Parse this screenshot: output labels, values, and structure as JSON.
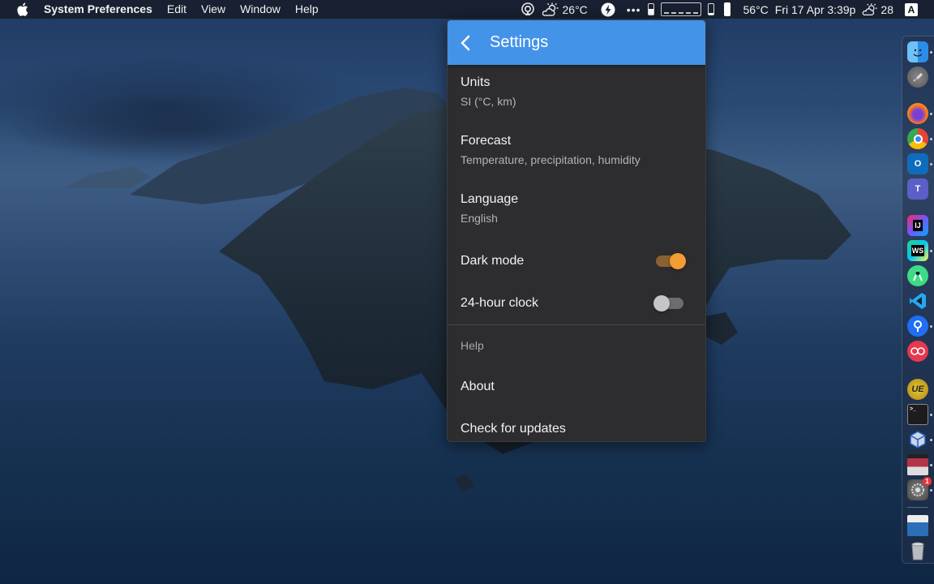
{
  "menubar": {
    "app_name": "System Preferences",
    "menus": [
      "Edit",
      "View",
      "Window",
      "Help"
    ],
    "status": {
      "weather_temp": "26°C",
      "cpu_temp": "56°C",
      "datetime": "Fri 17 Apr 3:39p",
      "weather_temp2": "28",
      "input_source": "A"
    }
  },
  "settings": {
    "title": "Settings",
    "rows": [
      {
        "primary": "Units",
        "secondary": "SI (°C, km)"
      },
      {
        "primary": "Forecast",
        "secondary": "Temperature, precipitation, humidity"
      },
      {
        "primary": "Language",
        "secondary": "English"
      }
    ],
    "toggles": [
      {
        "label": "Dark mode",
        "on": true
      },
      {
        "label": "24-hour clock",
        "on": false
      }
    ],
    "help_header": "Help",
    "help_items": [
      "About",
      "Check for updates"
    ],
    "colors": {
      "header": "#4393e8",
      "toggle_on": "#f39c33",
      "panel": "#2d2d2f"
    }
  },
  "dock": {
    "items": [
      {
        "name": "Finder",
        "icon": "finder-icon",
        "running": true
      },
      {
        "name": "Launchpad",
        "icon": "launchpad-icon",
        "running": false
      },
      {
        "name": "Firefox",
        "icon": "firefox-icon",
        "running": true
      },
      {
        "name": "Chrome",
        "icon": "chrome-icon",
        "running": true
      },
      {
        "name": "Outlook",
        "icon": "outlook-icon",
        "running": true
      },
      {
        "name": "Teams",
        "icon": "teams-icon",
        "running": false
      },
      {
        "name": "IntelliJ IDEA",
        "icon": "intellij-icon",
        "running": false
      },
      {
        "name": "WebStorm",
        "icon": "webstorm-icon",
        "running": true
      },
      {
        "name": "Android Studio",
        "icon": "android-studio-icon",
        "running": false
      },
      {
        "name": "VS Code",
        "icon": "vscode-icon",
        "running": false
      },
      {
        "name": "Sourcetree",
        "icon": "sourcetree-icon",
        "running": true
      },
      {
        "name": "Flickr",
        "icon": "flickr-icon",
        "running": false
      },
      {
        "name": "UltraEdit",
        "icon": "ultraedit-icon",
        "running": false
      },
      {
        "name": "Terminal",
        "icon": "terminal-icon",
        "running": true
      },
      {
        "name": "VirtualBox",
        "icon": "virtualbox-icon",
        "running": true
      },
      {
        "name": "Screenshot Editor",
        "icon": "screenshot-editor-icon",
        "running": true
      },
      {
        "name": "System Preferences",
        "icon": "system-preferences-icon",
        "running": true,
        "badge": "1"
      },
      {
        "name": "Downloads",
        "icon": "downloads-folder-icon",
        "running": false
      },
      {
        "name": "Trash",
        "icon": "trash-icon",
        "running": false
      }
    ]
  }
}
